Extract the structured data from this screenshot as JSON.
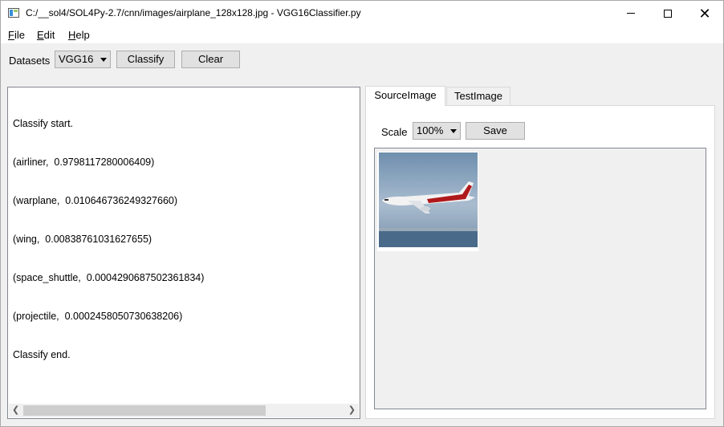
{
  "window": {
    "title": "C:/__sol4/SOL4Py-2.7/cnn/images/airplane_128x128.jpg - VGG16Classifier.py"
  },
  "menu": {
    "items": [
      {
        "key": "F",
        "rest": "ile"
      },
      {
        "key": "E",
        "rest": "dit"
      },
      {
        "key": "H",
        "rest": "elp"
      }
    ]
  },
  "toolbar": {
    "datasets_label": "Datasets",
    "dataset_value": "VGG16",
    "classify_label": "Classify",
    "clear_label": "Clear"
  },
  "output": {
    "lines": [
      "Classify start.",
      "(airliner,  0.9798117280006409)",
      "(warplane,  0.010646736249327660)",
      "(wing,  0.00838761031627655)",
      "(space_shuttle,  0.0004290687502361834)",
      "(projectile,  0.0002458050730638206)",
      "Classify end."
    ]
  },
  "tabs": {
    "items": [
      "SourceImage",
      "TestImage"
    ],
    "active": "SourceImage"
  },
  "image_panel": {
    "scale_label": "Scale",
    "scale_value": "100%",
    "save_label": "Save"
  },
  "colors": {
    "sky_top": "#6f8fae",
    "sky_bottom": "#a9bccf",
    "ground": "#4a6a8a",
    "fuselage": "#f2f2f2",
    "stripe": "#b0191b"
  }
}
